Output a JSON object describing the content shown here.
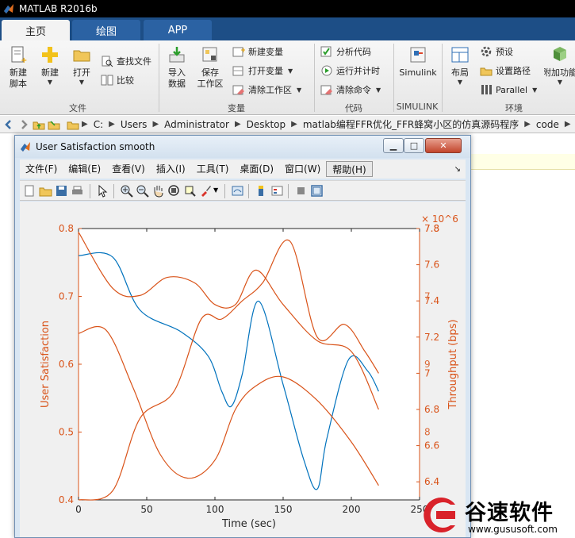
{
  "app": {
    "title": "MATLAB R2016b"
  },
  "tabs": [
    {
      "label": "主页",
      "active": true
    },
    {
      "label": "绘图",
      "active": false
    },
    {
      "label": "APP",
      "active": false
    }
  ],
  "ribbon": {
    "file": {
      "new_script": "新建\n脚本",
      "new": "新建",
      "open": "打开",
      "find_files": "查找文件",
      "compare": "比较",
      "group": "文件"
    },
    "variable": {
      "import_data": "导入\n数据",
      "save_workspace": "保存\n工作区",
      "new_variable": "新建变量",
      "open_variable": "打开变量",
      "clear_workspace": "清除工作区",
      "group": "变量"
    },
    "code": {
      "analyze_code": "分析代码",
      "run_and_time": "运行并计时",
      "clear_commands": "清除命令",
      "group": "代码"
    },
    "simulink": {
      "simulink": "Simulink",
      "group": "SIMULINK"
    },
    "environment": {
      "layout": "布局",
      "preferences": "预设",
      "set_path": "设置路径",
      "parallel": "Parallel",
      "addons": "附加功能",
      "group": "环境"
    }
  },
  "address": {
    "segments": [
      "C:",
      "Users",
      "Administrator",
      "Desktop",
      "matlab编程FFR优化_FFR蜂窝小区的仿真源码程序",
      "code"
    ]
  },
  "figure": {
    "title": "User Satisfaction smooth",
    "menu": [
      "文件(F)",
      "编辑(E)",
      "查看(V)",
      "插入(I)",
      "工具(T)",
      "桌面(D)",
      "窗口(W)",
      "帮助(H)"
    ],
    "menu_selected": "帮助(H)"
  },
  "chart_data": {
    "type": "line",
    "xlabel": "Time (sec)",
    "ylabel": "User Satisfaction",
    "ylabel_right": "Throughput (bps)",
    "right_exponent": "× 10^6",
    "xlim": [
      0,
      250
    ],
    "ylim": [
      0.4,
      0.8
    ],
    "x_ticks": [
      "0",
      "50",
      "100",
      "150",
      "200",
      "250"
    ],
    "y_ticks_left": [
      "0.4",
      "0.5",
      "0.6",
      "0.7",
      "0.8"
    ],
    "y_ticks_right": [
      "6.4",
      "6.6",
      "6.8",
      "7",
      "7.2",
      "7.4",
      "7.6",
      "7.8"
    ],
    "right_overlap_ticks": [
      "7.8",
      "7",
      "9",
      "6",
      "8",
      "5"
    ],
    "colors": {
      "left": "#0072BD",
      "right": "#D95319",
      "axis_left": "#D95319",
      "axis_right": "#D95319"
    },
    "series": [
      {
        "axis": "left",
        "x": [
          0,
          25,
          45,
          75,
          95,
          105,
          112,
          120,
          132,
          150,
          165,
          175,
          182,
          198,
          212,
          220
        ],
        "y": [
          0.76,
          0.758,
          0.68,
          0.648,
          0.612,
          0.56,
          0.538,
          0.585,
          0.693,
          0.57,
          0.46,
          0.416,
          0.49,
          0.607,
          0.59,
          0.56
        ]
      },
      {
        "axis": "right",
        "x": [
          0,
          25,
          45,
          65,
          85,
          100,
          115,
          130,
          150,
          175,
          200,
          220
        ],
        "y": [
          7.78,
          7.47,
          7.43,
          7.53,
          7.5,
          7.38,
          7.38,
          7.57,
          7.38,
          7.18,
          7.12,
          6.8
        ]
      },
      {
        "axis": "right",
        "x": [
          0,
          20,
          40,
          60,
          80,
          100,
          115,
          130,
          150,
          175,
          200,
          220
        ],
        "y": [
          7.22,
          7.24,
          6.92,
          6.55,
          6.42,
          6.52,
          6.8,
          6.93,
          6.98,
          6.85,
          6.62,
          6.38
        ]
      },
      {
        "axis": "right",
        "x": [
          0,
          25,
          45,
          70,
          90,
          105,
          120,
          135,
          155,
          175,
          195,
          210,
          220
        ],
        "y": [
          6.3,
          6.35,
          6.75,
          6.9,
          7.3,
          7.3,
          7.4,
          7.5,
          7.73,
          7.2,
          7.27,
          7.12,
          7.0
        ]
      }
    ]
  },
  "watermark": {
    "text": "谷速软件",
    "url": "www.gususoft.com"
  }
}
